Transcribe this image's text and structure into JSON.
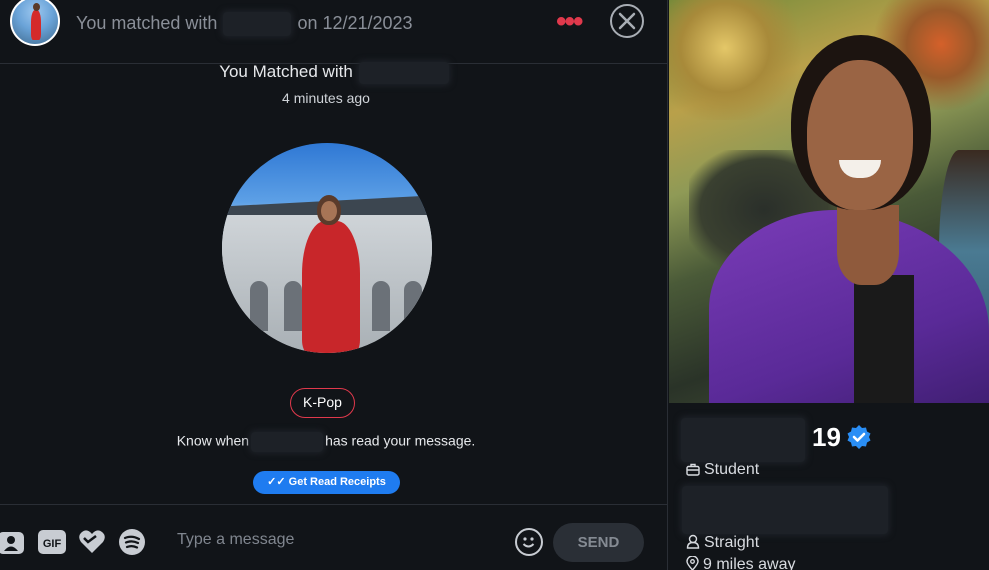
{
  "header": {
    "text_prefix": "You matched with",
    "text_suffix": "on 12/21/2023"
  },
  "match": {
    "title": "You Matched with",
    "time": "4 minutes ago"
  },
  "interest_tag": "K-Pop",
  "read_receipt": {
    "prefix": "Know when",
    "suffix": "has read your message.",
    "button_label": "Get Read Receipts"
  },
  "composer": {
    "gif_label": "GIF",
    "placeholder": "Type a message",
    "send_label": "SEND"
  },
  "profile": {
    "age": "19",
    "occupation": "Student",
    "orientation": "Straight",
    "distance": "9 miles away"
  },
  "colors": {
    "accent": "#e0394c",
    "blue": "#1f7cf0",
    "background": "#111418"
  },
  "icons": {
    "more": "ellipsis-icon",
    "close": "close-circle-icon",
    "verified": "verified-badge-icon"
  }
}
